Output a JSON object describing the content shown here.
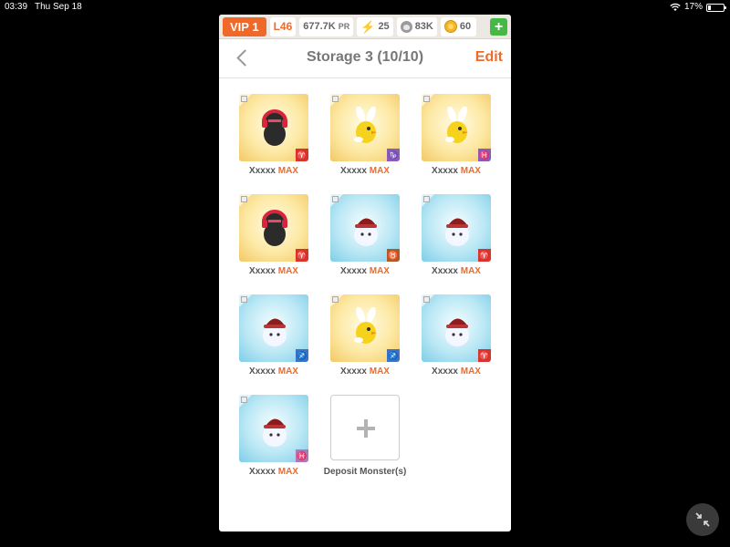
{
  "status_bar": {
    "time": "03:39",
    "date": "Thu Sep 18",
    "battery": "17%",
    "battery_level": 0.17
  },
  "topbar": {
    "vip": "VIP 1",
    "level": "L46",
    "power": "677.7K",
    "power_suffix": "PR",
    "energy": "25",
    "food": "83K",
    "coins": "60",
    "add_label": "+"
  },
  "header": {
    "title": "Storage 3 (10/10)",
    "edit": "Edit"
  },
  "slots": [
    {
      "name": "Xxxxx",
      "tag": "MAX",
      "bg": "gold",
      "monster": "black-red-headphones",
      "badge_color": "red",
      "badge": "♈"
    },
    {
      "name": "Xxxxx",
      "tag": "MAX",
      "bg": "gold",
      "monster": "yellow-bunny-bird",
      "badge_color": "purple",
      "badge": "♑"
    },
    {
      "name": "Xxxxx",
      "tag": "MAX",
      "bg": "gold",
      "monster": "yellow-bunny-bird",
      "badge_color": "purple",
      "badge": "♓"
    },
    {
      "name": "Xxxxx",
      "tag": "MAX",
      "bg": "gold",
      "monster": "black-red-headphones",
      "badge_color": "red",
      "badge": "♈"
    },
    {
      "name": "Xxxxx",
      "tag": "MAX",
      "bg": "blue",
      "monster": "white-ghost-santa-hat",
      "badge_color": "brown",
      "badge": "♉"
    },
    {
      "name": "Xxxxx",
      "tag": "MAX",
      "bg": "blue",
      "monster": "white-ghost-santa-hat",
      "badge_color": "red",
      "badge": "♈"
    },
    {
      "name": "Xxxxx",
      "tag": "MAX",
      "bg": "blue",
      "monster": "white-ghost-santa-hat",
      "badge_color": "blue",
      "badge": "♐"
    },
    {
      "name": "Xxxxx",
      "tag": "MAX",
      "bg": "gold",
      "monster": "yellow-bunny-bird",
      "badge_color": "blue",
      "badge": "♐"
    },
    {
      "name": "Xxxxx",
      "tag": "MAX",
      "bg": "blue",
      "monster": "white-ghost-santa-hat",
      "badge_color": "red",
      "badge": "♈"
    },
    {
      "name": "Xxxxx",
      "tag": "MAX",
      "bg": "blue",
      "monster": "white-ghost-santa-hat",
      "badge_color": "pink",
      "badge": "♓"
    }
  ],
  "deposit": {
    "label": "Deposit Monster(s)"
  },
  "colors": {
    "accent": "#ef6a2a",
    "add_green": "#45b845"
  },
  "icons": {
    "back": "chevron-left-icon",
    "energy": "lightning-icon",
    "food": "paw-icon",
    "coins": "coin-icon",
    "compress": "compress-arrows-icon"
  }
}
